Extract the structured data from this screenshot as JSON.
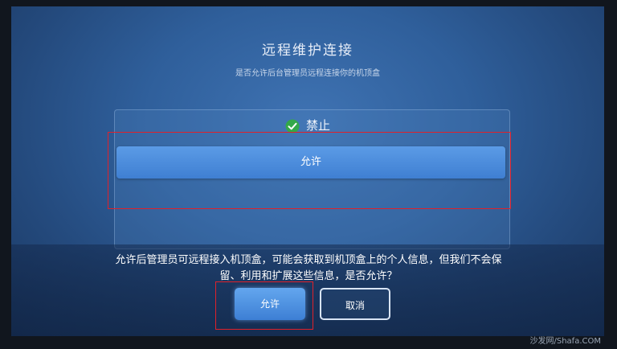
{
  "dialog": {
    "title": "远程维护连接",
    "subtitle": "是否允许后台管理员远程连接你的机顶盒"
  },
  "options": {
    "deny_label": "禁止",
    "allow_label": "允许"
  },
  "confirm": {
    "prompt": "允许后管理员可远程接入机顶盒，可能会获取到机顶盒上的个人信息，但我们不会保留、利用和扩展这些信息，是否允许？",
    "allow_label": "允许",
    "cancel_label": "取消"
  },
  "watermark": "沙发网/Shafa.COM",
  "colors": {
    "background": "#2f5f9b",
    "accent": "#4a8ee0",
    "highlight": "#e0212a",
    "check": "#33a84a"
  }
}
